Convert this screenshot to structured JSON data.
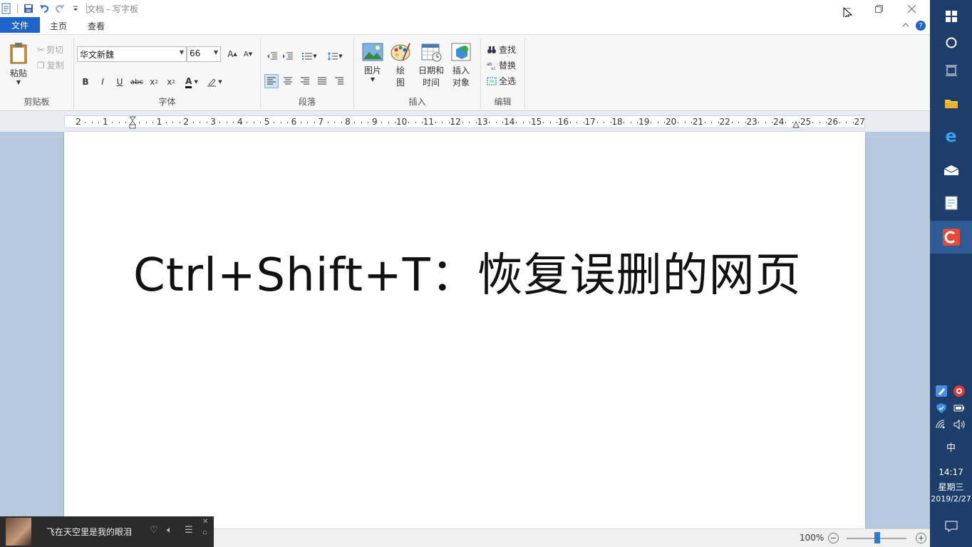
{
  "window": {
    "title": "文档 - 写字板"
  },
  "tabs": {
    "file": "文件",
    "home": "主页",
    "view": "查看"
  },
  "clipboard": {
    "paste": "粘贴",
    "cut": "剪切",
    "copy": "复制",
    "group": "剪贴板"
  },
  "font": {
    "family": "华文新魏",
    "size": "66",
    "group": "字体"
  },
  "paragraph": {
    "group": "段落"
  },
  "insert": {
    "picture": "图片",
    "paint_1": "绘",
    "paint_2": "图",
    "datetime_1": "日期和",
    "datetime_2": "时间",
    "object_1": "插入",
    "object_2": "对象",
    "group": "插入"
  },
  "edit": {
    "find": "查找",
    "replace": "替换",
    "select_all": "全选",
    "group": "编辑"
  },
  "ruler": {
    "labels": [
      "2",
      "1",
      "",
      "1",
      "2",
      "3",
      "4",
      "5",
      "6",
      "7",
      "8",
      "9",
      "10",
      "11",
      "12",
      "13",
      "14",
      "15",
      "16",
      "17",
      "18",
      "19",
      "20",
      "21",
      "22",
      "23",
      "24",
      "25",
      "26",
      "27"
    ]
  },
  "document": {
    "text": "Ctrl+Shift+T：恢复误删的网页"
  },
  "status": {
    "zoom": "100%"
  },
  "music": {
    "song": "飞在天空里是我的眼泪"
  },
  "taskbar": {
    "ime": "中",
    "time": "14:17",
    "weekday": "星期三",
    "date": "2019/2/27"
  },
  "colors": {
    "file_tab": "#1e64c8",
    "taskbar": "#1d3e6b",
    "page_bg": "#b7c9de"
  }
}
